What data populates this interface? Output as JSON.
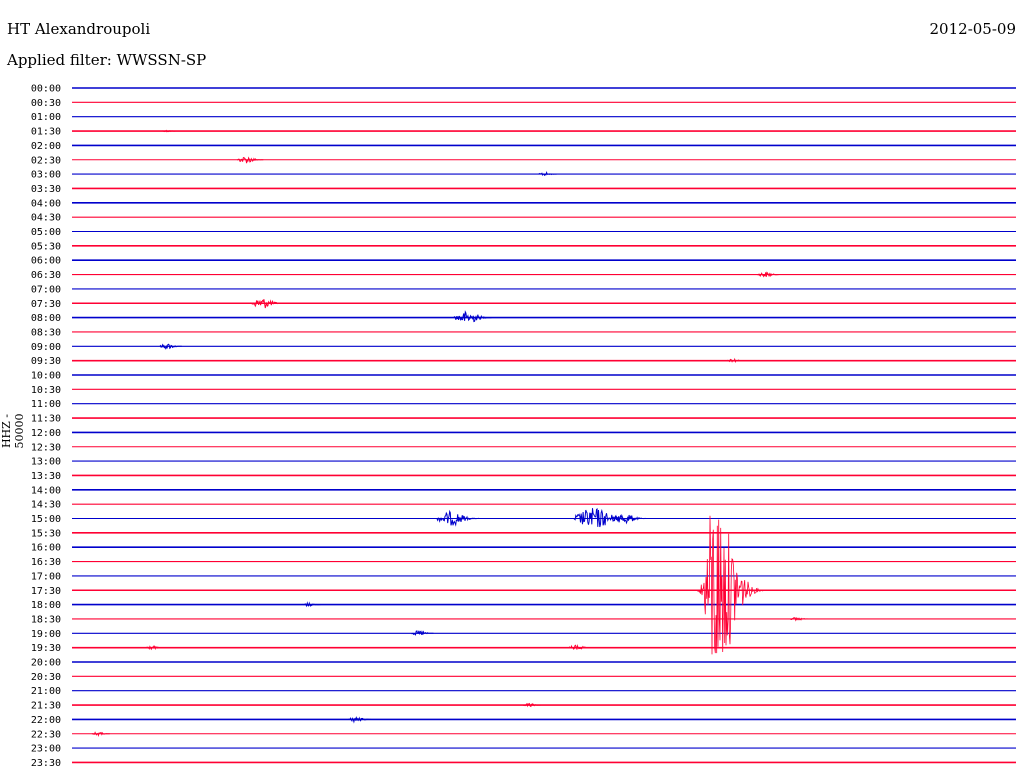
{
  "header": {
    "station": "HT Alexandroupoli",
    "date": "2012-05-09",
    "filter": "Applied filter: WWSSN-SP",
    "channel_label": "HHZ - 50000"
  },
  "colors": {
    "trace_a": "#0000cc",
    "trace_b": "#ff0033"
  },
  "chart_data": {
    "type": "line",
    "title": "HT Alexandroupoli",
    "subtitle": "Applied filter: WWSSN-SP",
    "ylabel": "HHZ - 50000",
    "xlabel": "",
    "rows": [
      "00:00",
      "00:30",
      "01:00",
      "01:30",
      "02:00",
      "02:30",
      "03:00",
      "03:30",
      "04:00",
      "04:30",
      "05:00",
      "05:30",
      "06:00",
      "06:30",
      "07:00",
      "07:30",
      "08:00",
      "08:30",
      "09:00",
      "09:30",
      "10:00",
      "10:30",
      "11:00",
      "11:30",
      "12:00",
      "12:30",
      "13:00",
      "13:30",
      "14:00",
      "14:30",
      "15:00",
      "15:30",
      "16:00",
      "16:30",
      "17:00",
      "17:30",
      "18:00",
      "18:30",
      "19:00",
      "19:30",
      "20:00",
      "20:30",
      "21:00",
      "21:30",
      "22:00",
      "22:30",
      "23:00",
      "23:30"
    ],
    "row_minutes": 30,
    "events": [
      {
        "row": "01:30",
        "minute": 3,
        "amplitude": 1
      },
      {
        "row": "02:30",
        "minute": 5.5,
        "amplitude": 4
      },
      {
        "row": "03:00",
        "minute": 15,
        "amplitude": 2
      },
      {
        "row": "06:30",
        "minute": 22,
        "amplitude": 3
      },
      {
        "row": "07:30",
        "minute": 6,
        "amplitude": 6
      },
      {
        "row": "08:00",
        "minute": 12.5,
        "amplitude": 7
      },
      {
        "row": "09:00",
        "minute": 3,
        "amplitude": 3
      },
      {
        "row": "09:30",
        "minute": 21,
        "amplitude": 2
      },
      {
        "row": "15:00",
        "minute": 12,
        "amplitude": 8
      },
      {
        "row": "15:00",
        "minute": 16.5,
        "amplitude": 12
      },
      {
        "row": "15:00",
        "minute": 17.5,
        "amplitude": 6
      },
      {
        "row": "17:30",
        "minute": 20,
        "amplitude": 95
      },
      {
        "row": "18:00",
        "minute": 7.5,
        "amplitude": 2
      },
      {
        "row": "18:30",
        "minute": 23,
        "amplitude": 2
      },
      {
        "row": "19:00",
        "minute": 11,
        "amplitude": 3
      },
      {
        "row": "19:30",
        "minute": 2.5,
        "amplitude": 2
      },
      {
        "row": "19:30",
        "minute": 16,
        "amplitude": 3
      },
      {
        "row": "21:30",
        "minute": 14.5,
        "amplitude": 2
      },
      {
        "row": "22:00",
        "minute": 9,
        "amplitude": 3
      },
      {
        "row": "22:30",
        "minute": 0.8,
        "amplitude": 2
      }
    ]
  }
}
